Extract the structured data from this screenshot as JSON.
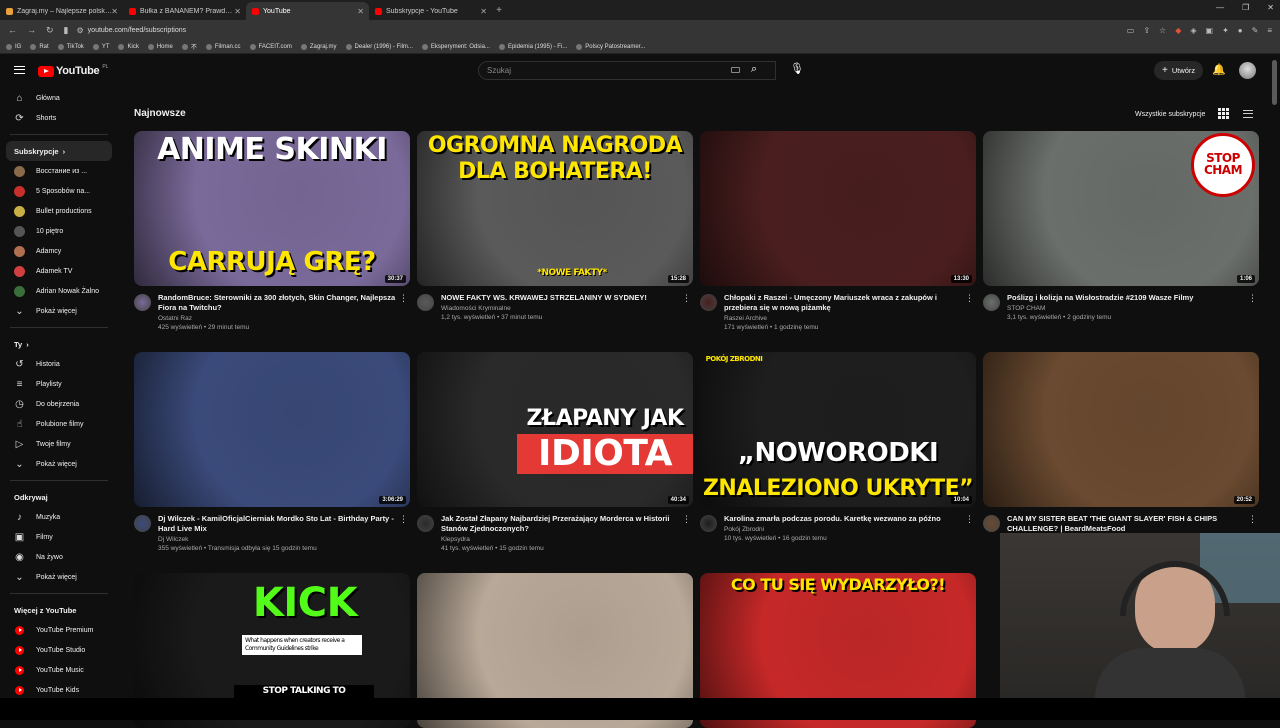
{
  "browser": {
    "tabs": [
      {
        "title": "Zagraj.my – Najlepsze polskie quizy",
        "color": "#e8a13b",
        "active": false
      },
      {
        "title": "Bułka z BANANEM? Prawda o Sukces",
        "color": "#ff0000",
        "active": false
      },
      {
        "title": "YouTube",
        "color": "#ff0000",
        "active": true
      },
      {
        "title": "Subskrypcje - YouTube",
        "color": "#ff0000",
        "active": false
      }
    ],
    "url": "youtube.com/feed/subscriptions",
    "bookmarks": [
      "IG",
      "Rat",
      "TikTok",
      "YT",
      "Kick",
      "Home",
      "不",
      "Filman.cc",
      "FACEIT.com",
      "Zagraj.my",
      "Dealer (1996) - Film...",
      "Eksperyment: Odsia...",
      "Epidemia (1995) - Fi...",
      "Polscy Patostreamer..."
    ]
  },
  "header": {
    "logo_text": "YouTube",
    "logo_region": "PL",
    "search_placeholder": "Szukaj",
    "create_label": "Utwórz"
  },
  "sidebar": {
    "main": [
      {
        "label": "Główna",
        "icon": "home-icon"
      },
      {
        "label": "Shorts",
        "icon": "shorts-icon"
      }
    ],
    "subs_heading": "Subskrypcje",
    "subs": [
      {
        "label": "Восстание из ...",
        "color": "#8a6a4a"
      },
      {
        "label": "5 Sposobów na...",
        "color": "#c9302c"
      },
      {
        "label": "Bullet productions",
        "color": "#c8b044"
      },
      {
        "label": "10 piętro",
        "color": "#555555"
      },
      {
        "label": "Adamcy",
        "color": "#b07050"
      },
      {
        "label": "Adamek TV",
        "color": "#d04040"
      },
      {
        "label": "Adrian Nowak Żalno",
        "color": "#3a6e3a"
      }
    ],
    "subs_more": "Pokaż więcej",
    "you_heading": "Ty",
    "you": [
      {
        "label": "Historia",
        "icon": "history-icon",
        "glyph": "↺"
      },
      {
        "label": "Playlisty",
        "icon": "playlist-icon",
        "glyph": "≡"
      },
      {
        "label": "Do obejrzenia",
        "icon": "watch-later-icon",
        "glyph": "◷"
      },
      {
        "label": "Polubione filmy",
        "icon": "thumb-up-icon",
        "glyph": "☝"
      },
      {
        "label": "Twoje filmy",
        "icon": "your-videos-icon",
        "glyph": "▷"
      }
    ],
    "you_more": "Pokaż więcej",
    "explore_heading": "Odkrywaj",
    "explore": [
      {
        "label": "Muzyka",
        "icon": "music-icon",
        "glyph": "♪"
      },
      {
        "label": "Filmy",
        "icon": "film-icon",
        "glyph": "▣"
      },
      {
        "label": "Na żywo",
        "icon": "live-icon",
        "glyph": "◉"
      }
    ],
    "explore_more": "Pokaż więcej",
    "more_heading": "Więcej z YouTube",
    "more": [
      "YouTube Premium",
      "YouTube Studio",
      "YouTube Music",
      "YouTube Kids"
    ]
  },
  "main": {
    "title": "Najnowsze",
    "all_subs": "Wszystkie subskrypcje"
  },
  "videos": [
    {
      "title": "RandomBruce: Sterowniki za 300 złotych, Skin Changer, Najlepsza Fiora na Twitchu?",
      "channel": "Ostatni Raz",
      "stats": "425 wyświetleń • 29 minut temu",
      "duration": "30:37",
      "thumb_text": "ANIME SKINKI",
      "thumb_text2": "CARRUJĄ GRĘ?",
      "bg": "#7a6a9a"
    },
    {
      "title": "NOWE FAKTY WS. KRWAWEJ STRZELANINY W SYDNEY!",
      "channel": "Wiadomości Kryminalne",
      "stats": "1,2 tys. wyświetleń • 37 minut temu",
      "duration": "15:28",
      "thumb_text": "OGROMNA NAGRODA",
      "thumb_text2": "DLA BOHATERA!",
      "thumb_text3": "*NOWE FAKTY*",
      "bg": "#5a5a5a"
    },
    {
      "title": "Chłopaki z Raszei - Umęczony Mariuszek wraca z zakupów i przebiera się w nową piżamkę",
      "channel": "Raszei Archive",
      "stats": "171 wyświetleń • 1 godzinę temu",
      "duration": "13:30",
      "bg": "#4a1e1e"
    },
    {
      "title": "Poślizg i kolizja na Wisłostradzie #2109 Wasze Filmy",
      "channel": "STOP CHAM",
      "stats": "3,1 tys. wyświetleń • 2 godziny temu",
      "duration": "1:06",
      "thumb_text": "STOP CHAM",
      "bg": "#6b6f6b"
    },
    {
      "title": "Dj Wilczek - KamilOficjalCierniak Mordko Sto Lat - Birthday Party - Hard Live Mix",
      "channel": "Dj Wilczek",
      "stats": "355 wyświetleń • Transmisja odbyła się 15 godzin temu",
      "duration": "3:06:29",
      "bg": "#3a4a7a"
    },
    {
      "title": "Jak Został Złapany Najbardziej Przerażający Morderca w Historii Stanów Zjednoczonych?",
      "channel": "Klepsydra",
      "stats": "41 tys. wyświetleń • 15 godzin temu",
      "duration": "40:34",
      "thumb_text": "ZŁAPANY JAK",
      "thumb_text2": "IDIOTA",
      "bg": "#2a2a2a"
    },
    {
      "title": "Karolina zmarła podczas porodu. Karetkę wezwano za późno",
      "channel": "Pokój Zbrodni",
      "stats": "10 tys. wyświetleń • 16 godzin temu",
      "duration": "10:04",
      "thumb_text": "„NOWORODKI",
      "thumb_text2": "ZNALEZIONO UKRYTE”",
      "thumb_text3": "POKÓJ ZBRODNI",
      "bg": "#1e1e1e"
    },
    {
      "title": "CAN MY SISTER BEAT 'THE GIANT SLAYER' FISH & CHIPS CHALLENGE? | BeardMeatsFood",
      "channel": "",
      "stats": "",
      "duration": "20:52",
      "bg": "#6a4a30"
    },
    {
      "title": "",
      "channel": "",
      "stats": "",
      "duration": "",
      "thumb_text": "KICK",
      "thumb_text2": "What happens when creators receive a Community Guidelines strike",
      "thumb_text3": "STOP TALKING TO",
      "bg": "#1a1a1a"
    },
    {
      "title": "",
      "channel": "",
      "stats": "",
      "duration": "",
      "bg": "#b8a898"
    },
    {
      "title": "",
      "channel": "",
      "stats": "",
      "duration": "",
      "thumb_text": "CO TU SIĘ WYDARZYŁO?!",
      "bg": "#c62828"
    }
  ]
}
